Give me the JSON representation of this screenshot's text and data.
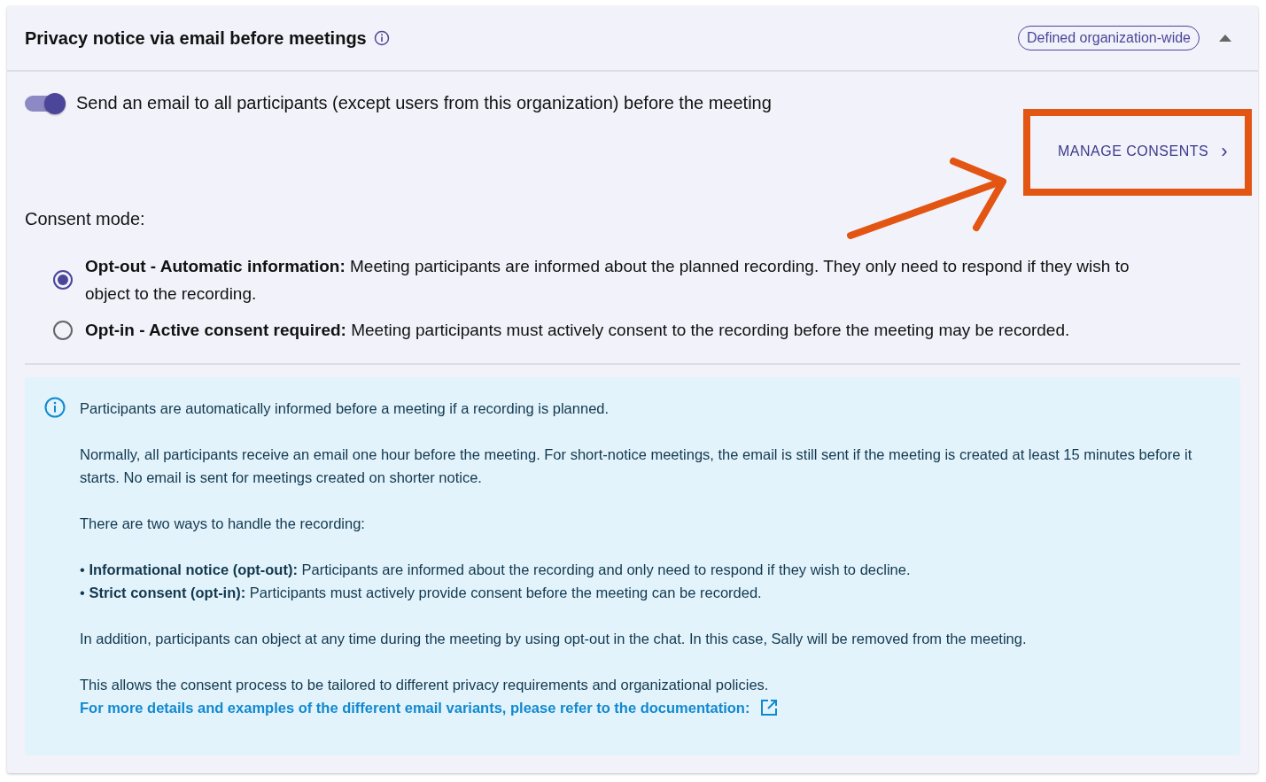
{
  "header": {
    "title": "Privacy notice via email before meetings",
    "badge": "Defined organization-wide",
    "expanded": true
  },
  "email_toggle": {
    "label": "Send an email to all participants (except users from this organization) before the meeting",
    "on": true
  },
  "manage_button": {
    "label": "MANAGE CONSENTS",
    "icon": "›"
  },
  "consent_mode": {
    "label": "Consent mode:",
    "options": [
      {
        "text": "**Opt-out - Automatic information:** Meeting participants are informed about the planned recording. They only need to respond if they wish to object to the recording.",
        "selected": true
      },
      {
        "text": "**Opt-in - Active consent required:** Meeting participants must actively consent to the recording before the meeting may be recorded.",
        "selected": false
      }
    ]
  },
  "info_box": {
    "paragraphs": [
      {
        "kind": "text",
        "lines": [
          "Participants are automatically informed before a meeting if a recording is planned."
        ]
      },
      {
        "kind": "text",
        "lines": [
          "Normally, all participants receive an email one hour before the meeting. For short-notice meetings, the email is still sent if the meeting is created at least 15 minutes before it starts. No email is sent for meetings created on shorter notice."
        ]
      },
      {
        "kind": "text",
        "lines": [
          "There are two ways to handle the recording:"
        ]
      },
      {
        "kind": "text",
        "lines": [
          "• **Informational notice (opt-out):** Participants are informed about the recording and only need to respond if they wish to decline.",
          "• **Strict consent (opt-in):** Participants must actively provide consent before the meeting can be recorded."
        ]
      },
      {
        "kind": "text",
        "lines": [
          "In addition, participants can object at any time during the meeting by using opt-out in the chat. In this case, Sally will be removed from the meeting."
        ]
      },
      {
        "kind": "text",
        "lines": [
          "This allows the consent process to be tailored to different privacy requirements and organizational policies."
        ]
      }
    ],
    "link": "For more details and examples of the different email variants, please refer to the documentation:"
  }
}
